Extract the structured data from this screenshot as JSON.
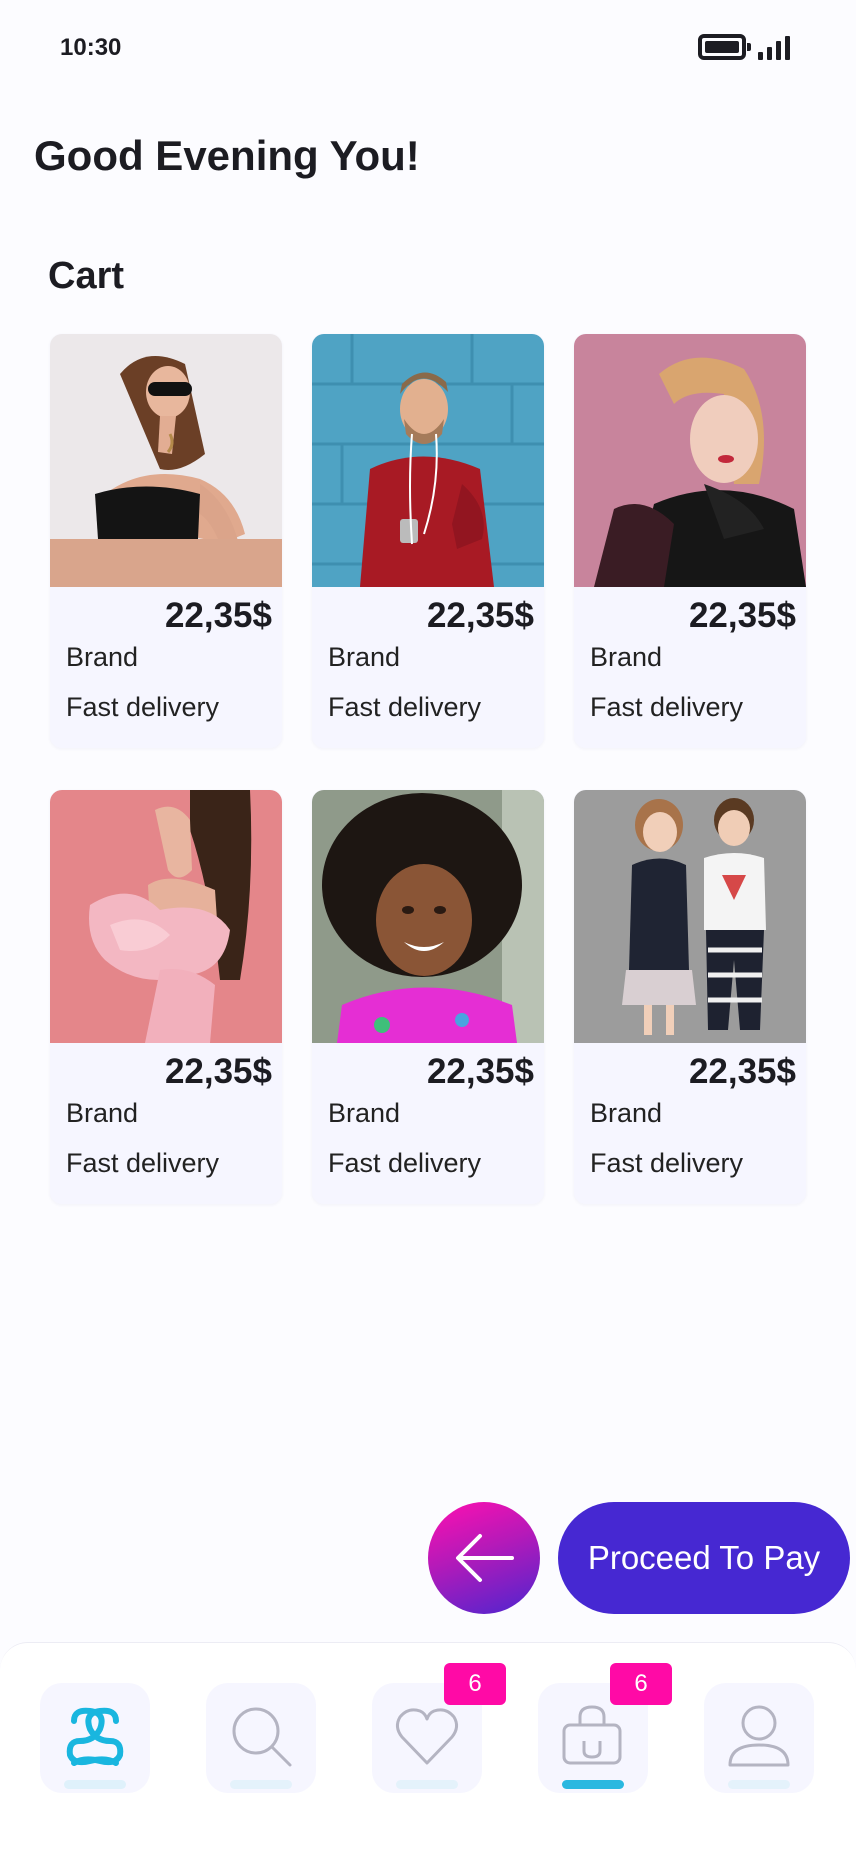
{
  "status_bar": {
    "time": "10:30",
    "icons": [
      "battery-icon",
      "signal-icon"
    ]
  },
  "greeting": "Good Evening You!",
  "section_title": "Cart",
  "products": [
    {
      "price": "22,35$",
      "brand": "Brand",
      "delivery": "Fast delivery",
      "photo": "woman-sunglasses-photo"
    },
    {
      "price": "22,35$",
      "brand": "Brand",
      "delivery": "Fast delivery",
      "photo": "man-red-sweater-photo"
    },
    {
      "price": "22,35$",
      "brand": "Brand",
      "delivery": "Fast delivery",
      "photo": "woman-black-scarf-photo"
    },
    {
      "price": "22,35$",
      "brand": "Brand",
      "delivery": "Fast delivery",
      "photo": "woman-pink-dress-photo"
    },
    {
      "price": "22,35$",
      "brand": "Brand",
      "delivery": "Fast delivery",
      "photo": "girl-pink-top-photo"
    },
    {
      "price": "22,35$",
      "brand": "Brand",
      "delivery": "Fast delivery",
      "photo": "kids-pair-photo"
    }
  ],
  "actions": {
    "back_icon": "arrow-left-icon",
    "pay_label": "Proceed To Pay"
  },
  "nav": {
    "items": [
      {
        "icon": "logo-icon",
        "active": false
      },
      {
        "icon": "search-icon",
        "active": false
      },
      {
        "icon": "heart-icon",
        "badge": "6"
      },
      {
        "icon": "shopping-bag-icon",
        "badge": "6",
        "active": true
      },
      {
        "icon": "user-icon",
        "active": false
      }
    ]
  },
  "colors": {
    "accent": "#4628d2",
    "badge": "#ff0aa6",
    "active_indicator": "#2ab8e0",
    "card_bg": "#f6f6ff"
  }
}
